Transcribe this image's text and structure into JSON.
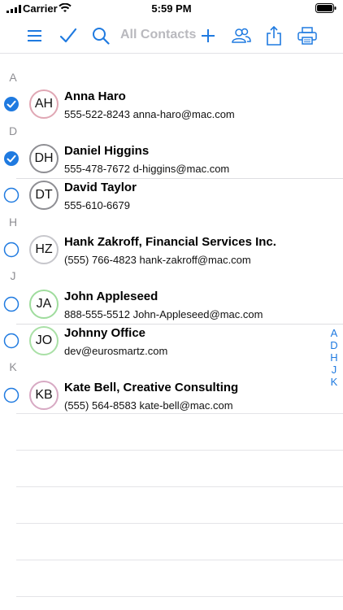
{
  "status": {
    "carrier": "Carrier",
    "time": "5:59 PM"
  },
  "toolbar": {
    "title": "All Contacts"
  },
  "sections": [
    "A",
    "D",
    "H",
    "J",
    "K"
  ],
  "contacts": [
    {
      "initials": "AH",
      "name": "Anna Haro",
      "detail": "555-522-8243 anna-haro@mac.com",
      "checked": true,
      "ring": "#e0a7b4"
    },
    {
      "initials": "DH",
      "name": "Daniel Higgins",
      "detail": "555-478-7672 d-higgins@mac.com",
      "checked": true,
      "ring": "#8e8e93"
    },
    {
      "initials": "DT",
      "name": "David Taylor",
      "detail": "555-610-6679",
      "checked": false,
      "ring": "#8e8e93"
    },
    {
      "initials": "HZ",
      "name": "Hank Zakroff, Financial Services Inc.",
      "detail": "(555) 766-4823 hank-zakroff@mac.com",
      "checked": false,
      "ring": "#c7c7cc"
    },
    {
      "initials": "JA",
      "name": "John Appleseed",
      "detail": "888-555-5512 John-Appleseed@mac.com",
      "checked": false,
      "ring": "#9fdc9d"
    },
    {
      "initials": "JO",
      "name": "Johnny Office",
      "detail": "dev@eurosmartz.com",
      "checked": false,
      "ring": "#a9e0a6"
    },
    {
      "initials": "KB",
      "name": "Kate Bell, Creative Consulting",
      "detail": "(555) 564-8583 kate-bell@mac.com",
      "checked": false,
      "ring": "#d7a9c3"
    }
  ],
  "index": [
    "A",
    "D",
    "H",
    "J",
    "K"
  ],
  "colors": {
    "accent": "#1f7ae0"
  }
}
